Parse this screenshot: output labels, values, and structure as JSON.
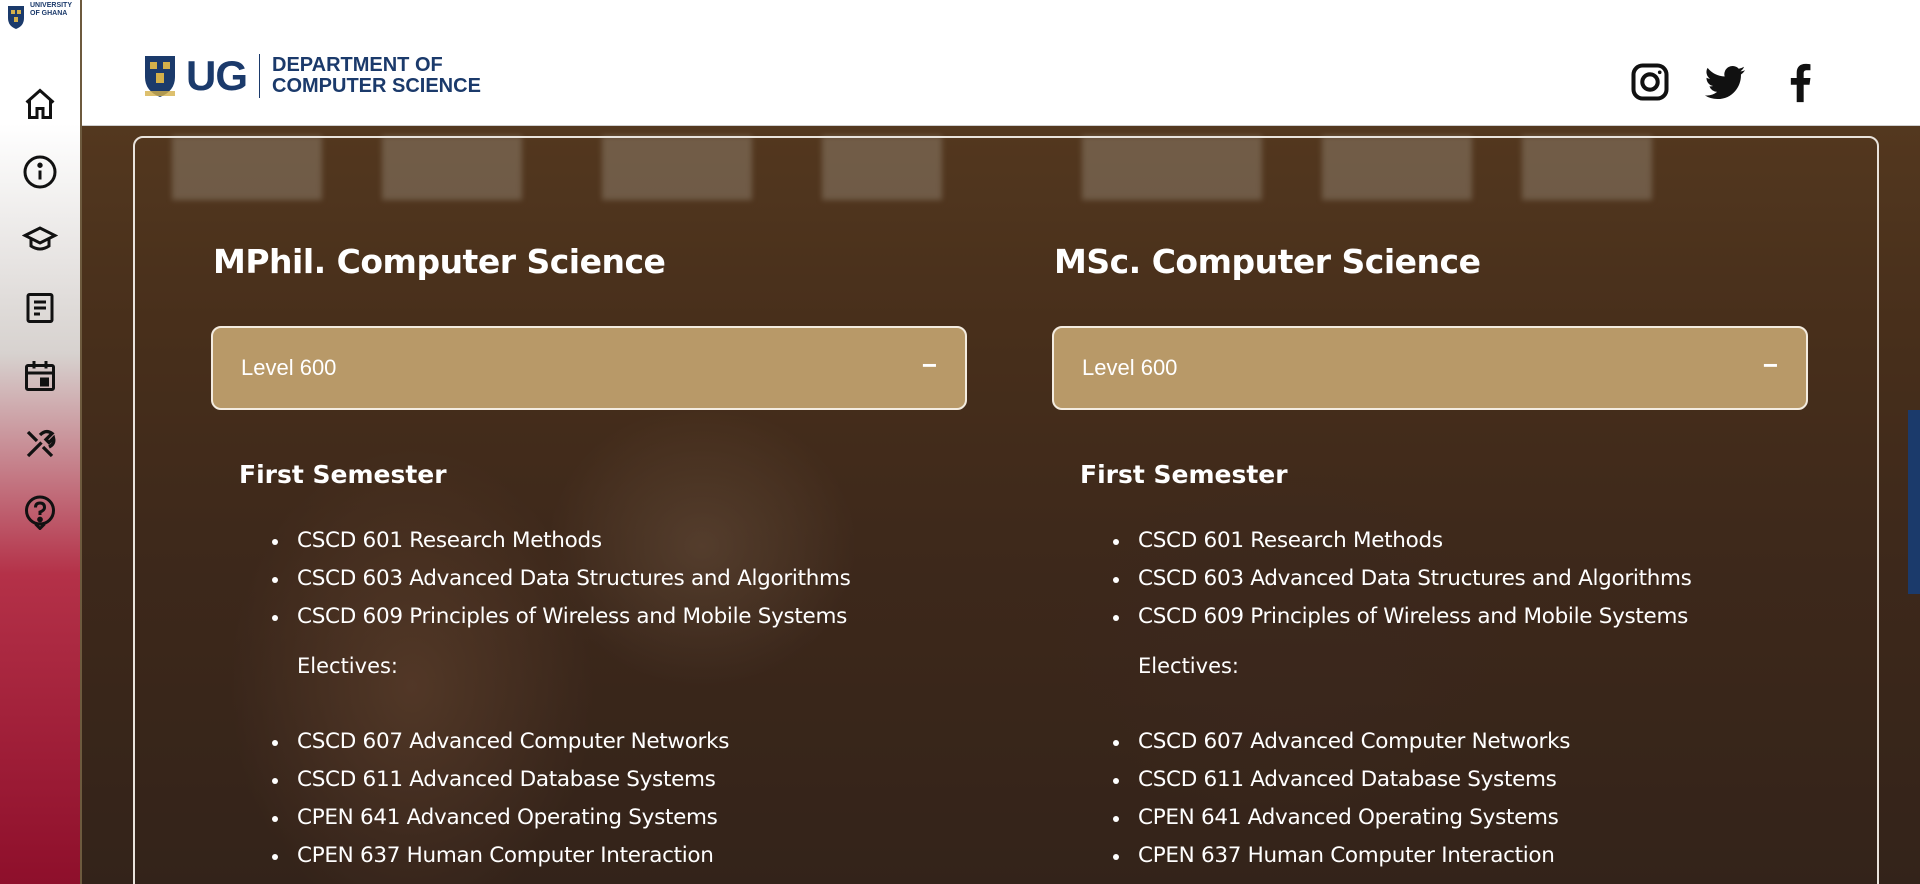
{
  "colors": {
    "brand_navy": "#1b3a6b",
    "level_bar": "#b89968",
    "sidebar_maroon": "#8e0f2b"
  },
  "sidebar": {
    "logo_text": "UNIVERSITY OF GHANA",
    "items": [
      {
        "icon": "home-icon"
      },
      {
        "icon": "info-icon"
      },
      {
        "icon": "graduation-cap-icon"
      },
      {
        "icon": "news-icon"
      },
      {
        "icon": "calendar-icon"
      },
      {
        "icon": "tools-icon"
      },
      {
        "icon": "help-icon"
      }
    ]
  },
  "header": {
    "brand_short": "UG",
    "dept_line1": "DEPARTMENT OF",
    "dept_line2": "COMPUTER SCIENCE",
    "social": [
      "instagram-icon",
      "twitter-icon",
      "facebook-icon"
    ]
  },
  "programs": [
    {
      "title": "MPhil. Computer Science",
      "level": "Level 600",
      "toggle": "−",
      "semester": "First Semester",
      "core": [
        "CSCD 601 Research Methods",
        "CSCD 603 Advanced Data Structures and Algorithms",
        "CSCD 609 Principles of Wireless and Mobile Systems"
      ],
      "electives_label": "Electives:",
      "electives": [
        "CSCD 607 Advanced Computer Networks",
        "CSCD 611 Advanced Database Systems",
        "CPEN 641 Advanced Operating Systems",
        "CPEN 637 Human Computer Interaction"
      ]
    },
    {
      "title": "MSc. Computer Science",
      "level": "Level 600",
      "toggle": "−",
      "semester": "First Semester",
      "core": [
        "CSCD 601 Research Methods",
        "CSCD 603 Advanced Data Structures and Algorithms",
        "CSCD 609 Principles of Wireless and Mobile Systems"
      ],
      "electives_label": "Electives:",
      "electives": [
        "CSCD 607 Advanced Computer Networks",
        "CSCD 611 Advanced Database Systems",
        "CPEN 641 Advanced Operating Systems",
        "CPEN 637 Human Computer Interaction"
      ]
    }
  ]
}
